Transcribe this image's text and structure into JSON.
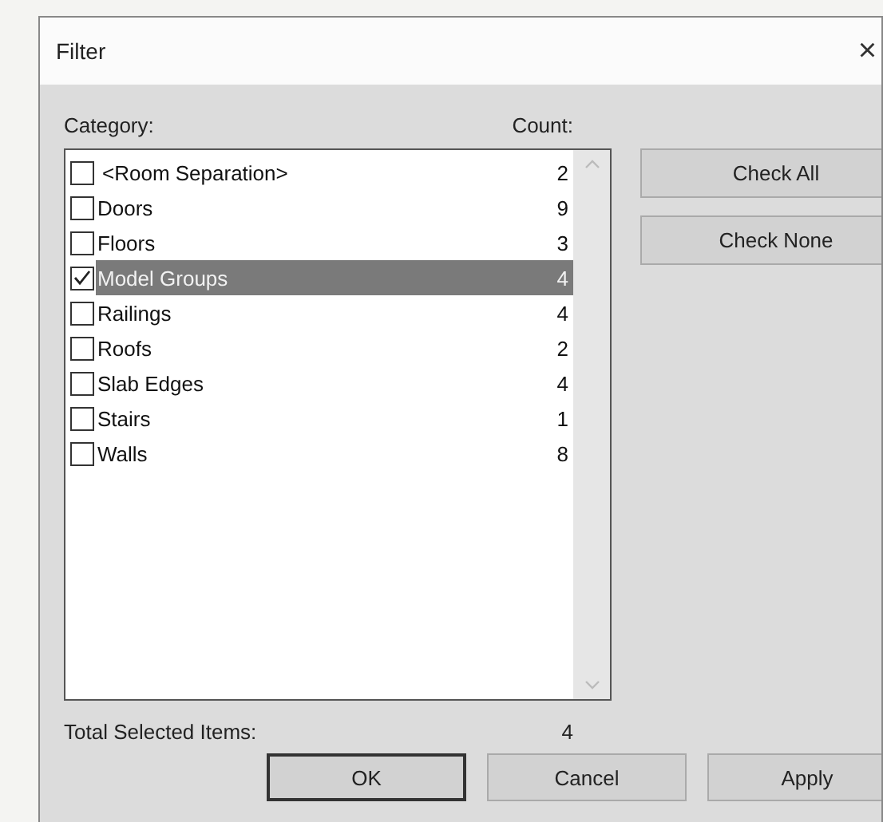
{
  "window": {
    "title": "Filter",
    "close": "×"
  },
  "headers": {
    "category": "Category:",
    "count": "Count:"
  },
  "categories": [
    {
      "name": "<Room Separation>",
      "count": "2",
      "checked": false,
      "selected": false
    },
    {
      "name": "Doors",
      "count": "9",
      "checked": false,
      "selected": false
    },
    {
      "name": "Floors",
      "count": "3",
      "checked": false,
      "selected": false
    },
    {
      "name": "Model Groups",
      "count": "4",
      "checked": true,
      "selected": true
    },
    {
      "name": "Railings",
      "count": "4",
      "checked": false,
      "selected": false
    },
    {
      "name": "Roofs",
      "count": "2",
      "checked": false,
      "selected": false
    },
    {
      "name": "Slab Edges",
      "count": "4",
      "checked": false,
      "selected": false
    },
    {
      "name": "Stairs",
      "count": "1",
      "checked": false,
      "selected": false
    },
    {
      "name": "Walls",
      "count": "8",
      "checked": false,
      "selected": false
    }
  ],
  "side_buttons": [
    "Check All",
    "Check None"
  ],
  "total": {
    "label": "Total Selected Items:",
    "value": "4"
  },
  "buttons": [
    {
      "label": "OK",
      "default": true
    },
    {
      "label": "Cancel",
      "default": false
    },
    {
      "label": "Apply",
      "default": false
    }
  ]
}
